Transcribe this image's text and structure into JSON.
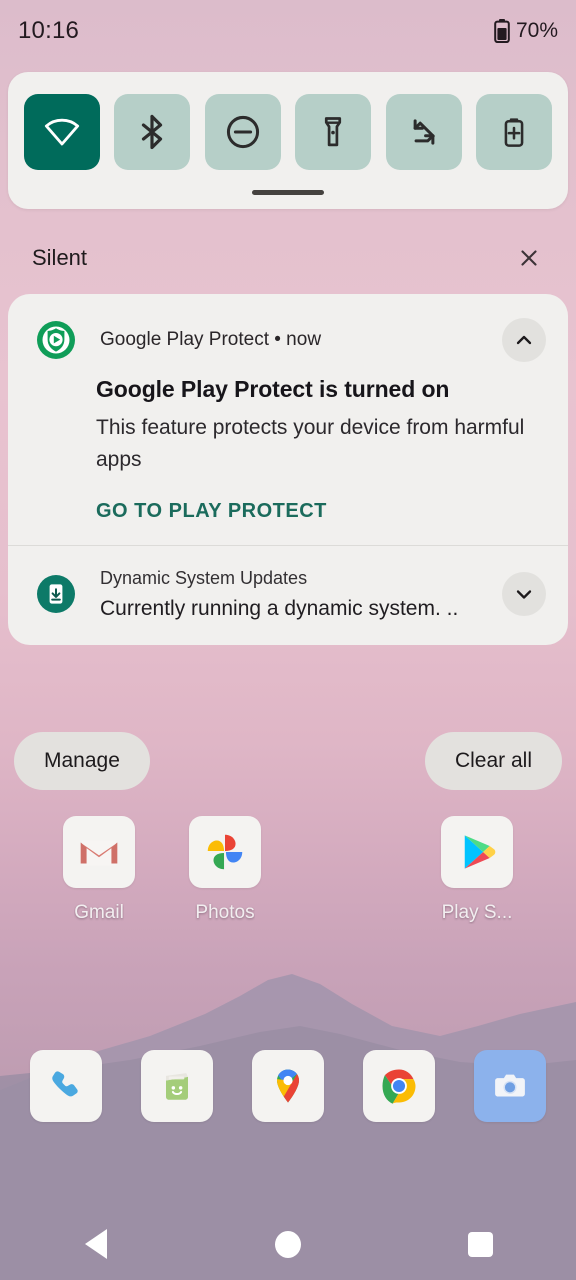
{
  "statusbar": {
    "clock": "10:16",
    "battery_percent": "70%",
    "battery_icon": "battery-icon"
  },
  "quick_settings": {
    "tiles": [
      {
        "name": "wifi",
        "icon": "wifi-icon",
        "label": "Wi-Fi",
        "active": true
      },
      {
        "name": "bluetooth",
        "icon": "bluetooth-icon",
        "label": "Bluetooth",
        "active": false
      },
      {
        "name": "dnd",
        "icon": "do-not-disturb-icon",
        "label": "Do Not Disturb",
        "active": false
      },
      {
        "name": "flashlight",
        "icon": "flashlight-icon",
        "label": "Flashlight",
        "active": false
      },
      {
        "name": "auto-rotate",
        "icon": "auto-rotate-icon",
        "label": "Auto-rotate",
        "active": false
      },
      {
        "name": "battery-saver",
        "icon": "battery-saver-icon",
        "label": "Battery Saver",
        "active": false
      }
    ],
    "active_color": "#006b5b",
    "inactive_color": "#b6cfc8",
    "handle": "drag-handle"
  },
  "shade": {
    "section_label": "Silent",
    "close_icon": "close-icon",
    "notifications": [
      {
        "app_name": "Google Play Protect",
        "time": "now",
        "header": "Google Play Protect • now",
        "title": "Google Play Protect is turned on",
        "text": "This feature protects your device from harmful apps",
        "action_label": "GO TO PLAY PROTECT",
        "action_color": "#1b6b5c",
        "app_icon": "play-protect-icon",
        "expand_icon": "chevron-up-icon",
        "expanded": true
      },
      {
        "app_name": "Dynamic System Updates",
        "summary": "Currently running a dynamic system. ..",
        "app_icon": "dynamic-system-updates-icon",
        "expand_icon": "chevron-down-icon",
        "expanded": false
      }
    ],
    "manage_label": "Manage",
    "clear_all_label": "Clear all"
  },
  "homescreen": {
    "apps": [
      {
        "label": "Gmail",
        "icon": "gmail-icon"
      },
      {
        "label": "Photos",
        "icon": "google-photos-icon"
      },
      {
        "label": "",
        "icon": ""
      },
      {
        "label": "Play S...",
        "icon": "play-store-icon"
      }
    ],
    "dock": [
      {
        "label": "Phone",
        "icon": "phone-icon"
      },
      {
        "label": "Messages",
        "icon": "messages-icon"
      },
      {
        "label": "Maps",
        "icon": "google-maps-icon"
      },
      {
        "label": "Chrome",
        "icon": "chrome-icon"
      },
      {
        "label": "Camera",
        "icon": "camera-icon"
      }
    ]
  },
  "navbar": {
    "back": "back-button",
    "home": "home-button",
    "recents": "recents-button"
  }
}
